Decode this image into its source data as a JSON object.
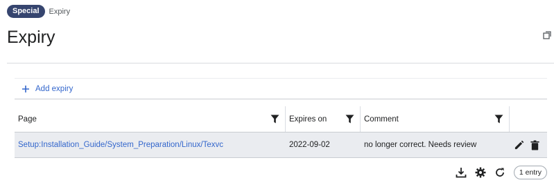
{
  "breadcrumb": {
    "badge": "Special",
    "current": "Expiry"
  },
  "page_title": "Expiry",
  "add_button": {
    "label": "Add expiry"
  },
  "table": {
    "columns": [
      {
        "key": "page",
        "label": "Page"
      },
      {
        "key": "expires_on",
        "label": "Expires on"
      },
      {
        "key": "comment",
        "label": "Comment"
      }
    ],
    "rows": [
      {
        "page": "Setup:Installation_Guide/System_Preparation/Linux/Texvc",
        "expires_on": "2022-09-02",
        "comment": "no longer correct. Needs review"
      }
    ]
  },
  "footer": {
    "count_label": "1 entry"
  },
  "icons": {
    "popout": "popout-icon",
    "add": "plus-icon",
    "filter": "filter-icon",
    "edit": "pencil-icon",
    "delete": "trash-icon",
    "export": "download-icon",
    "settings": "gear-icon",
    "reload": "reload-icon"
  },
  "colors": {
    "badge": "#36456f",
    "link": "#3366cc",
    "row_bg": "#eaecf0"
  }
}
